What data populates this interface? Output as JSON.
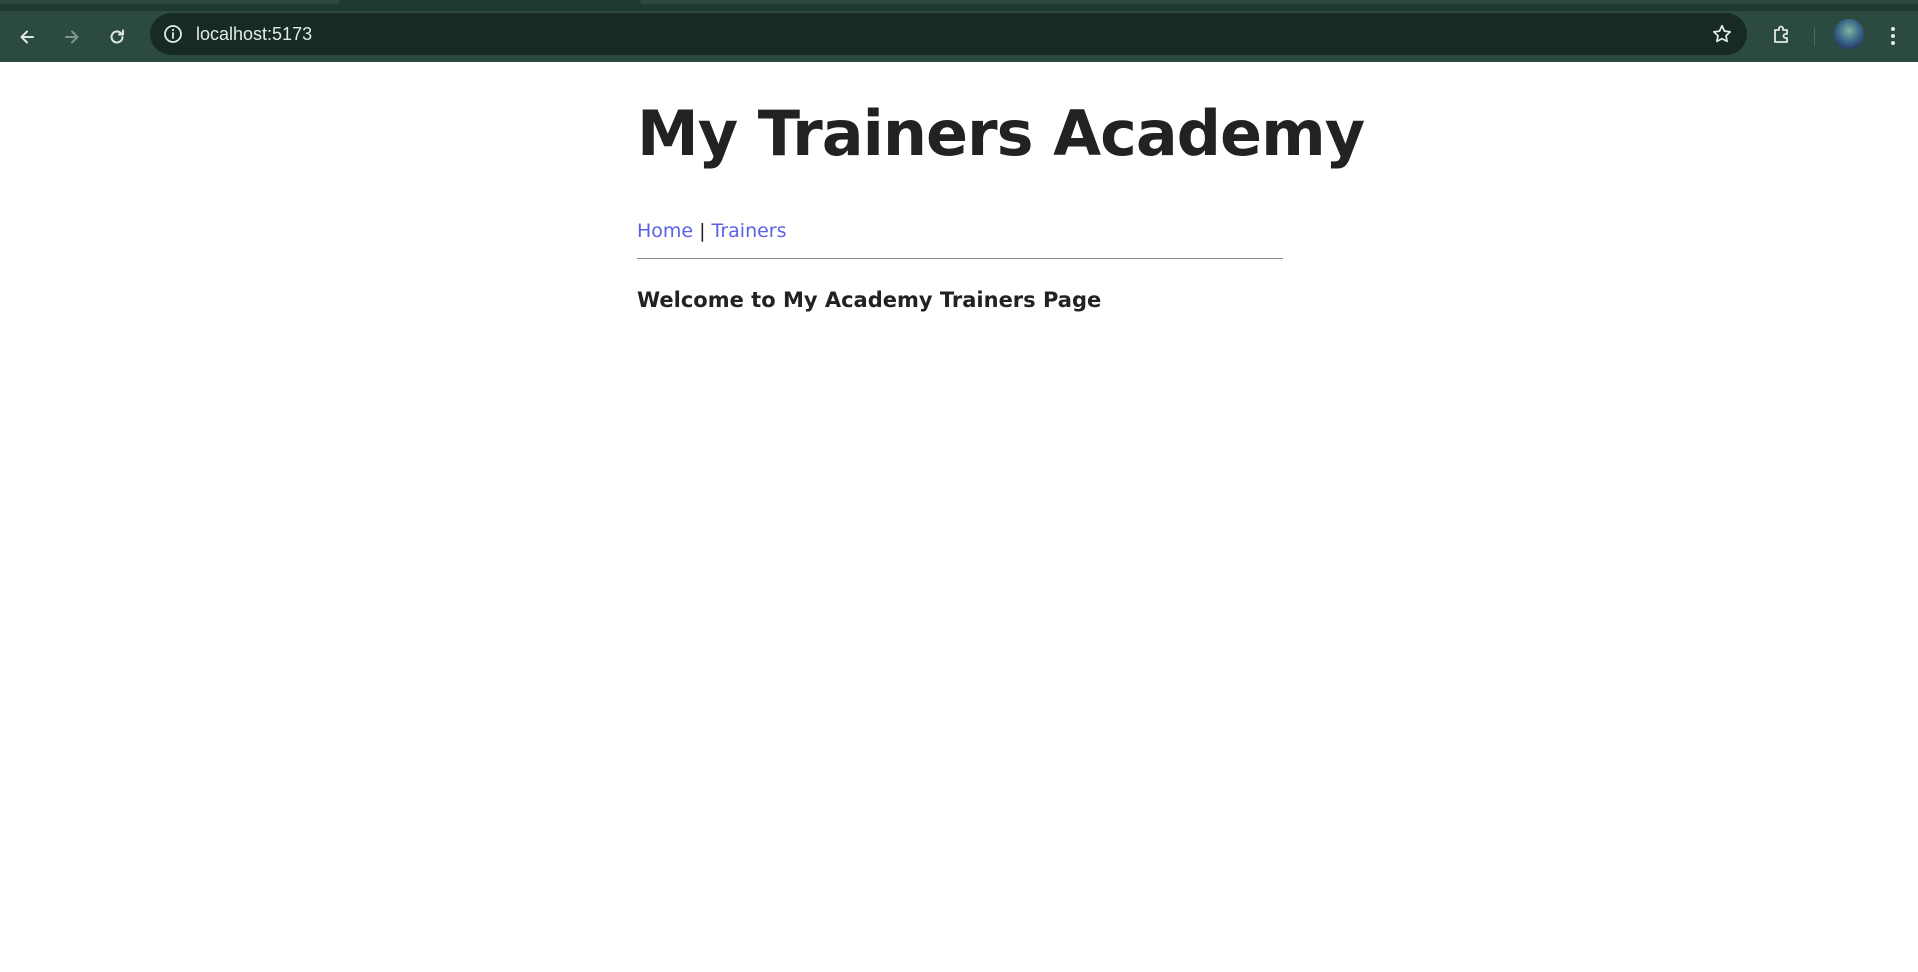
{
  "browser": {
    "url": "localhost:5173",
    "theme_color": "#2b4a40",
    "omnibox_color": "#172a25"
  },
  "icons": {
    "back": "arrow-left",
    "forward": "arrow-right",
    "reload": "reload",
    "site_info": "info-circle",
    "bookmark": "star-outline",
    "extensions": "puzzle-piece",
    "profile": "avatar",
    "menu": "three-dots-vertical"
  },
  "page": {
    "title": "My Trainers Academy",
    "nav": {
      "home_label": "Home",
      "separator": "|",
      "trainers_label": "Trainers",
      "link_color": "#5b60e8"
    },
    "welcome": "Welcome to My Academy Trainers Page"
  }
}
